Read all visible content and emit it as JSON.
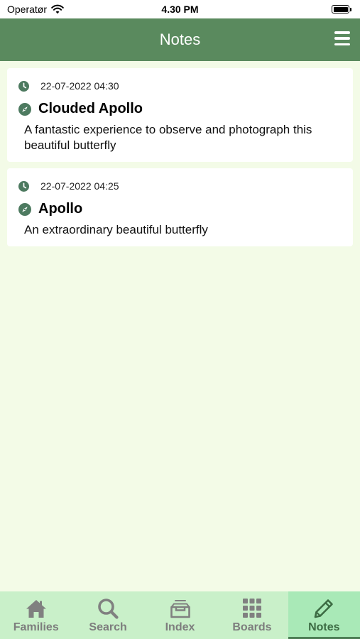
{
  "status_bar": {
    "carrier": "Operatør",
    "time": "4.30 PM"
  },
  "nav": {
    "title": "Notes"
  },
  "notes": [
    {
      "date": "22-07-2022 04:30",
      "title": "Clouded Apollo",
      "body": "A fantastic experience to observe and photograph this beautiful butterfly"
    },
    {
      "date": "22-07-2022 04:25",
      "title": "Apollo",
      "body": "An extraordinary beautiful butterfly"
    }
  ],
  "tabs": [
    {
      "label": "Families",
      "icon": "home-icon",
      "active": false
    },
    {
      "label": "Search",
      "icon": "search-icon",
      "active": false
    },
    {
      "label": "Index",
      "icon": "inbox-icon",
      "active": false
    },
    {
      "label": "Boards",
      "icon": "grid-icon",
      "active": false
    },
    {
      "label": "Notes",
      "icon": "pencil-icon",
      "active": true
    }
  ],
  "colors": {
    "nav_bar": "#5a8a5e",
    "background": "#f3fbe7",
    "tab_bar": "#c9f0c9",
    "tab_active": "#a9e9b7",
    "accent": "#3c6b43",
    "icon": "#4d7a60"
  }
}
